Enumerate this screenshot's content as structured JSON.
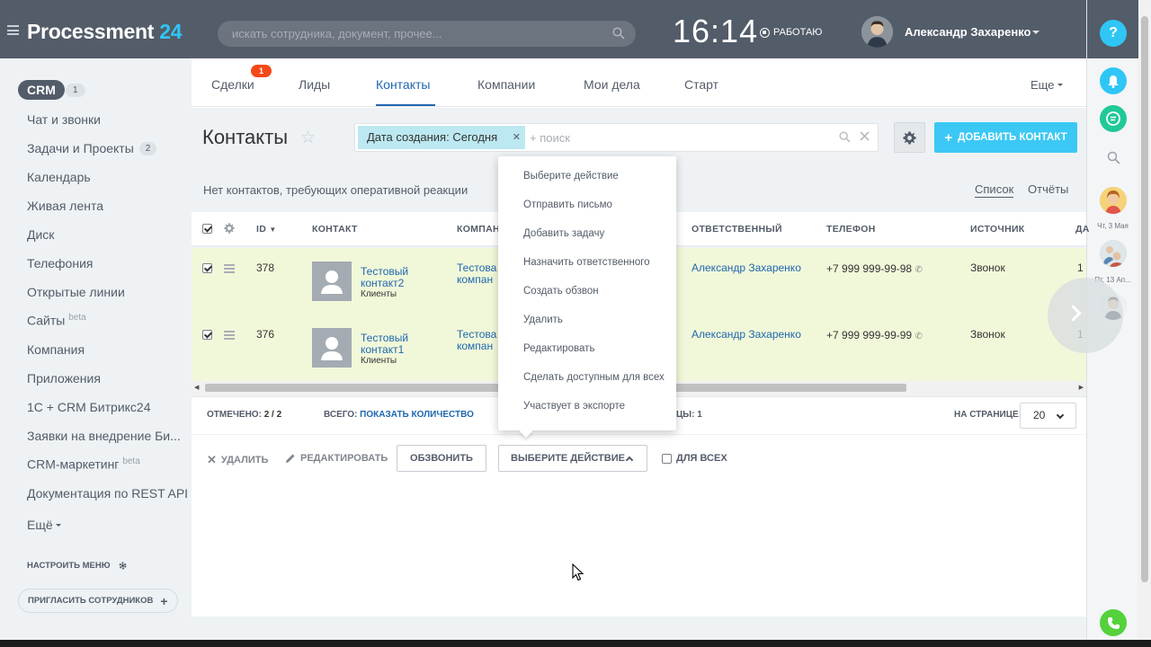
{
  "header": {
    "logo_main": "Processment",
    "logo_num": "24",
    "search_placeholder": "искать сотрудника, документ, прочее...",
    "clock": "16:14",
    "status": "РАБОТАЮ",
    "user_name": "Александр Захаренко"
  },
  "sidebar": {
    "crm_label": "CRM",
    "crm_count": "1",
    "items": [
      {
        "label": "Чат и звонки"
      },
      {
        "label": "Задачи и Проекты",
        "count": "2"
      },
      {
        "label": "Календарь"
      },
      {
        "label": "Живая лента"
      },
      {
        "label": "Диск"
      },
      {
        "label": "Телефония"
      },
      {
        "label": "Открытые линии"
      },
      {
        "label": "Сайты",
        "sup": "beta"
      },
      {
        "label": "Компания"
      },
      {
        "label": "Приложения"
      },
      {
        "label": "1С + CRM Битрикс24"
      },
      {
        "label": "Заявки на внедрение Би..."
      },
      {
        "label": "CRM-маркетинг",
        "sup": "beta"
      },
      {
        "label": "Документация по REST API"
      },
      {
        "label": "Ещё"
      }
    ],
    "configure": "НАСТРОИТЬ МЕНЮ",
    "invite": "ПРИГЛАСИТЬ СОТРУДНИКОВ"
  },
  "tabs": {
    "items": [
      "Сделки",
      "Лиды",
      "Контакты",
      "Компании",
      "Мои дела",
      "Старт"
    ],
    "deals_badge": "1",
    "more": "Еще"
  },
  "page": {
    "title": "Контакты",
    "filter_chip": "Дата создания: Сегодня",
    "filter_search": "+ поиск",
    "add_button": "ДОБАВИТЬ КОНТАКТ",
    "notice": "Нет контактов, требующих оперативной реакции",
    "view_list": "Список",
    "view_reports": "Отчёты"
  },
  "table": {
    "headers": {
      "id": "ID",
      "contact": "КОНТАКТ",
      "company": "КОМПАН",
      "responsible": "ОТВЕТСТВЕННЫЙ",
      "phone": "ТЕЛЕФОН",
      "source": "ИСТОЧНИК",
      "extra": "ДА"
    },
    "rows": [
      {
        "id": "378",
        "name1": "Тестовый",
        "name2": "контакт2",
        "type": "Клиенты",
        "company1": "Тестова",
        "company2": "компан",
        "responsible": "Александр Захаренко",
        "phone": "+7 999 999-99-98",
        "source": "Звонок",
        "extra": "1"
      },
      {
        "id": "376",
        "name1": "Тестовый",
        "name2": "контакт1",
        "type": "Клиенты",
        "company1": "Тестова",
        "company2": "компан",
        "responsible": "Александр Захаренко",
        "phone": "+7 999 999-99-99",
        "source": "Звонок",
        "extra": "1"
      }
    ]
  },
  "footer": {
    "marked_label": "ОТМЕЧЕНО:",
    "marked_value": "2 / 2",
    "total_label": "ВСЕГО:",
    "total_link": "ПОКАЗАТЬ КОЛИЧЕСТВО",
    "pages_fragment": "ЦЫ: 1",
    "per_page_label": "НА СТРАНИЦЕ:",
    "per_page_value": "20"
  },
  "actions": {
    "delete": "УДАЛИТЬ",
    "edit": "РЕДАКТИРОВАТЬ",
    "call": "ОБЗВОНИТЬ",
    "choose": "ВЫБЕРИТЕ ДЕЙСТВИЕ",
    "for_all": "ДЛЯ ВСЕХ"
  },
  "dropdown": {
    "items": [
      "Выберите действие",
      "Отправить письмо",
      "Добавить задачу",
      "Назначить ответственного",
      "Создать обзвон",
      "Удалить",
      "Редактировать",
      "Сделать доступным для всех",
      "Участвует в экспорте"
    ]
  },
  "rail": {
    "help": "?",
    "date1": "Чт, 3 Мая",
    "date2": "Пт, 13 Ап..."
  },
  "colors": {
    "header_bg": "#535c69",
    "accent_blue": "#2067b0",
    "add_button": "#3bc8f5",
    "row_selected": "#f1f8d9",
    "badge_red": "#f54819",
    "phone_green": "#55d13c"
  }
}
